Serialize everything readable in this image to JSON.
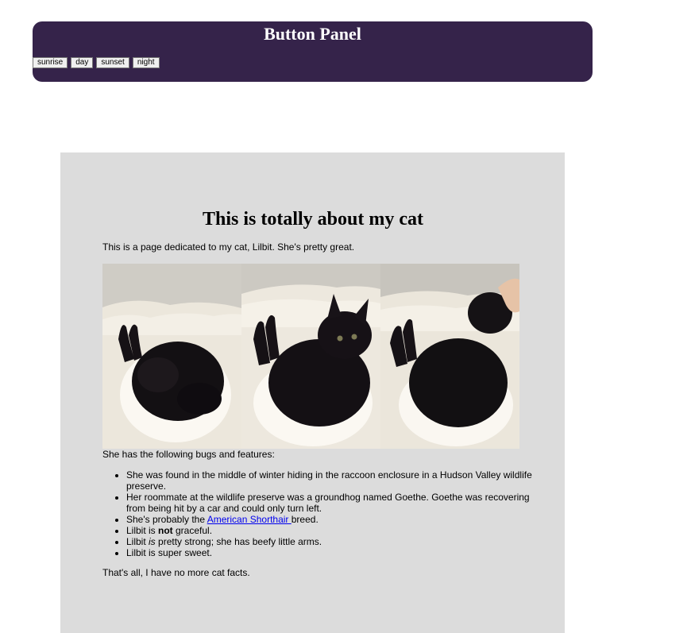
{
  "panel": {
    "title": "Button Panel",
    "buttons": [
      "sunrise",
      "day",
      "sunset",
      "night"
    ]
  },
  "page": {
    "heading": "This is totally about my cat",
    "intro": "This is a page dedicated to my cat, Lilbit. She's pretty great.",
    "features_label": "She has the following bugs and features:",
    "features": {
      "f1": "She was found in the middle of winter hiding in the raccoon enclosure in a Hudson Valley wildlife preserve.",
      "f2": "Her roommate at the wildlife preserve was a groundhog named Goethe. Goethe was recovering from being hit by a car and could only turn left.",
      "f3_pre": "She's probably the ",
      "f3_link": "American Shorthair ",
      "f3_post": "breed.",
      "f4_pre": "Lilbit is ",
      "f4_strong": "not",
      "f4_post": " graceful.",
      "f5_pre": "Lilbit ",
      "f5_em": "is",
      "f5_post": " pretty strong; she has beefy little arms.",
      "f6": "Lilbit is super sweet."
    },
    "outro": "That's all, I have no more cat facts."
  },
  "colors": {
    "panel_bg": "#35234a",
    "main_bg": "#dcdcdc",
    "link": "#0000ee"
  },
  "icons": [
    "cat-photo-curled",
    "cat-photo-looking",
    "cat-photo-petted"
  ]
}
